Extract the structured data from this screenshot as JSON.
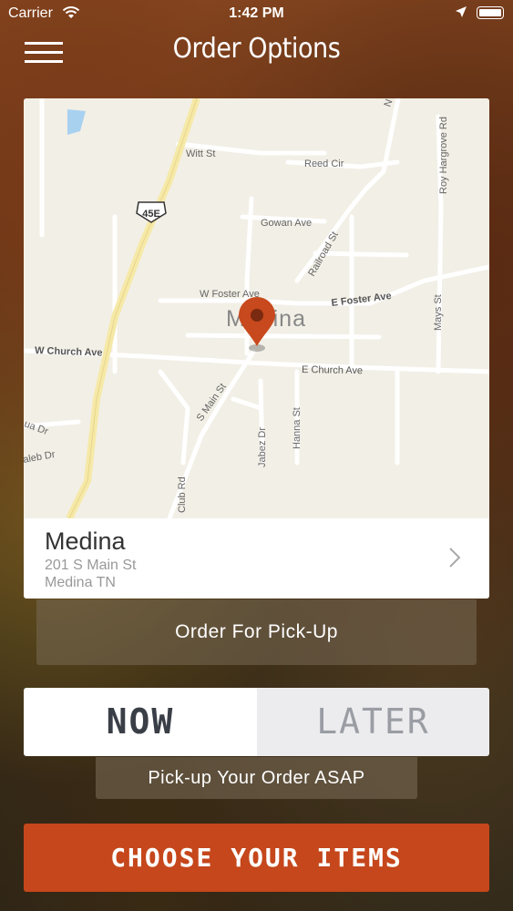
{
  "status_bar": {
    "carrier": "Carrier",
    "time": "1:42 PM"
  },
  "nav": {
    "title": "Order Options"
  },
  "map": {
    "city_label": "Medina",
    "streets": {
      "witt": "Witt St",
      "reed": "Reed Cir",
      "gowan": "Gowan Ave",
      "railroad": "Railroad St",
      "w_foster": "W Foster Ave",
      "e_foster": "E Foster Ave",
      "w_church": "W Church Ave",
      "e_church": "E Church Ave",
      "s_main": "S Main St",
      "jabez": "Jabez Dr",
      "hanna": "Hanna St",
      "club": "Club Rd",
      "mays": "Mays St",
      "roy": "Roy Hargrove Rd",
      "ua": "ua Dr",
      "aleb": "aleb Dr",
      "n": "N"
    },
    "highway_shield": "45E",
    "colors": {
      "land": "#f2efe6",
      "road": "#ffffff",
      "highway": "#f6e9a8",
      "water": "#a8d1f0",
      "pin": "#c8491d"
    }
  },
  "location": {
    "name": "Medina",
    "address_line1": "201 S Main St",
    "address_line2": "Medina TN",
    "icon": "chevron-right-icon"
  },
  "order_type": {
    "label": "Order For Pick-Up"
  },
  "timing": {
    "now_label": "NOW",
    "later_label": "LATER",
    "selected": "NOW",
    "description": "Pick-up Your Order ASAP"
  },
  "cta": {
    "label": "CHOOSE YOUR ITEMS",
    "color": "#c5471b"
  }
}
